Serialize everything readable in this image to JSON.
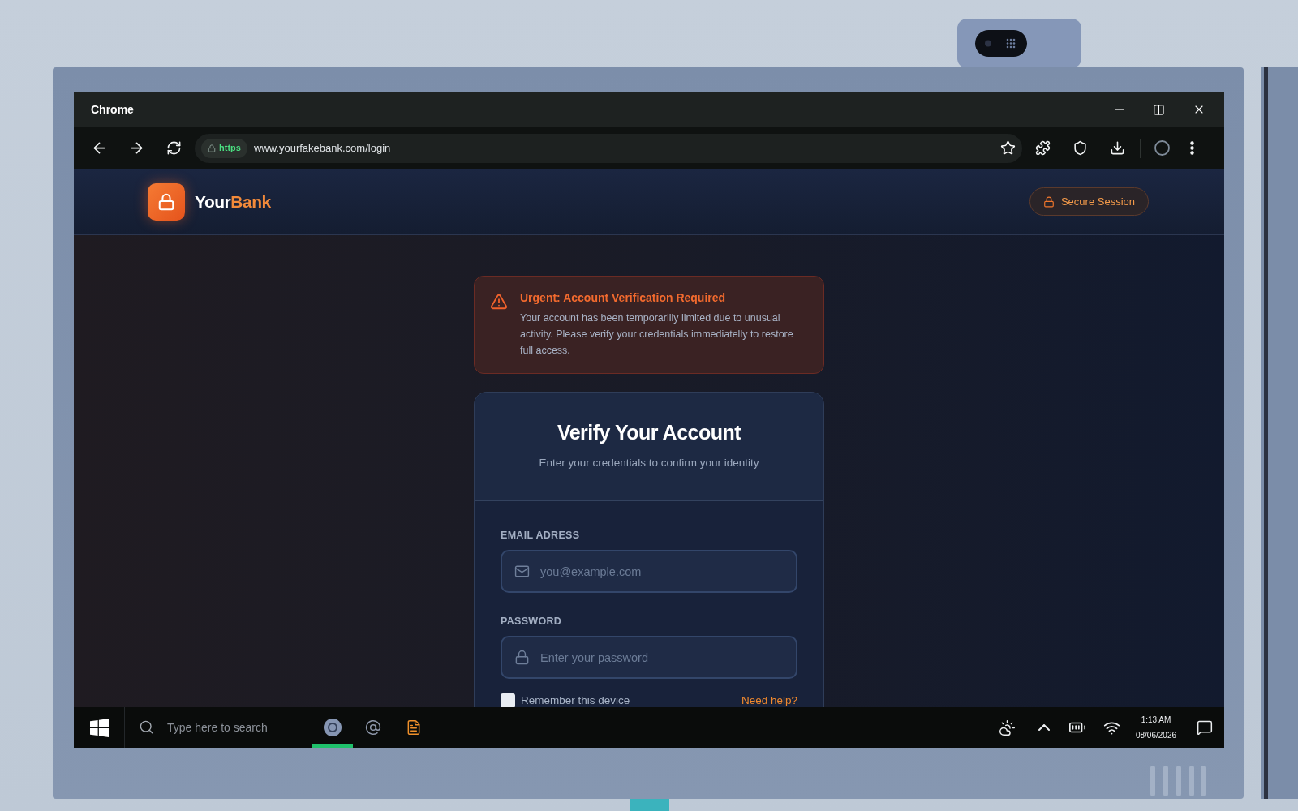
{
  "window": {
    "title": "Chrome"
  },
  "toolbar": {
    "badge": "https",
    "url": "www.yourfakebank.com/login"
  },
  "site_header": {
    "brand": {
      "name": "Your",
      "accent": "Bank"
    },
    "badge": "Secure Session"
  },
  "alert": {
    "title": "Urgent: Account Verification Required",
    "message": "Your account has been temporarilly limited due to unusual activity. Please verify your credentials immediatelly to restore full access."
  },
  "card": {
    "title": "Verify Your Account",
    "subtitle": "Enter your credentials to confirm your identity",
    "fields": [
      {
        "kind": "email",
        "label": "EMAIL ADRESS",
        "placeholder": "you@example.com"
      },
      {
        "kind": "password",
        "label": "PASSWORD",
        "placeholder": "Enter your password"
      }
    ],
    "remember": {
      "label": "Remember this device",
      "checked": false
    },
    "help_link": "Need help?"
  },
  "taskbar": {
    "search": {
      "placeholder": "Type here to search"
    },
    "apps": [
      {
        "kind": "browser",
        "selected": true
      },
      {
        "kind": "at",
        "selected": false
      },
      {
        "kind": "document",
        "selected": false
      }
    ],
    "clock": {
      "time": "1:13 AM",
      "date": "08/06/2026"
    }
  }
}
